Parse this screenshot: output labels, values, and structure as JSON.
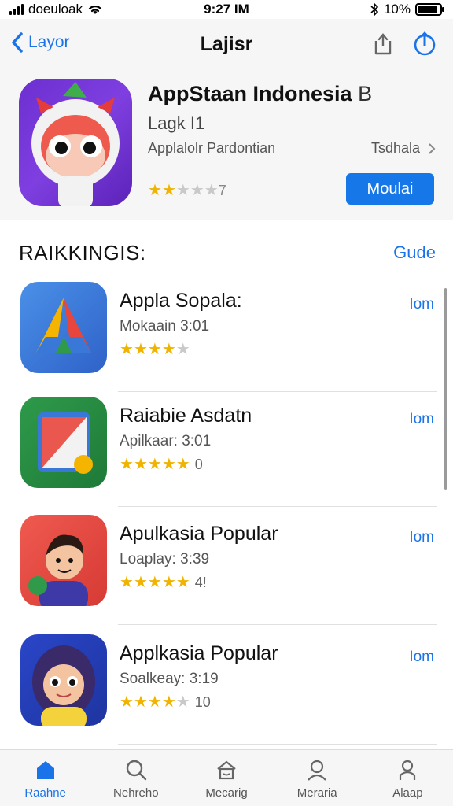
{
  "status": {
    "carrier": "doeuloak",
    "time": "9:27 IM",
    "battery": "10%",
    "battery_level": 0.9
  },
  "nav": {
    "back_label": "Layor",
    "title": "Lajisr"
  },
  "hero": {
    "title": "AppStaan Indonesia",
    "title_suffix": "B",
    "subtitle": "Lagk I1",
    "category": "Applalolr Pardontian",
    "category_right": "Tsdhala",
    "rating_count": "7",
    "stars": 1.5,
    "button_label": "Moulai"
  },
  "section": {
    "title": "RAIKKINGIS:",
    "link": "Gude"
  },
  "apps": [
    {
      "name": "Appla Sopala:",
      "subtitle": "Mokaain 3:01",
      "stars": 4,
      "count": "",
      "get_label": "Iom"
    },
    {
      "name": "Raiabie Asdatn",
      "subtitle": "Apilkaar: 3:01",
      "stars": 5,
      "count": "0",
      "get_label": "Iom"
    },
    {
      "name": "Apulkasia Popular",
      "subtitle": "Loaplay: 3:39",
      "stars": 5,
      "count": "4!",
      "get_label": "Iom"
    },
    {
      "name": "Applkasia Popular",
      "subtitle": "Soalkeay: 3:19",
      "stars": 4,
      "count": "10",
      "get_label": "Iom"
    }
  ],
  "tabs": [
    {
      "label": "Raahne",
      "icon": "home-icon",
      "active": true
    },
    {
      "label": "Nehreho",
      "icon": "search-icon",
      "active": false
    },
    {
      "label": "Mecarig",
      "icon": "store-icon",
      "active": false
    },
    {
      "label": "Meraria",
      "icon": "person-icon",
      "active": false
    },
    {
      "label": "Alaap",
      "icon": "profile-icon",
      "active": false
    }
  ],
  "colors": {
    "accent": "#1a73e8",
    "button": "#1677e8",
    "star": "#f0b400"
  }
}
